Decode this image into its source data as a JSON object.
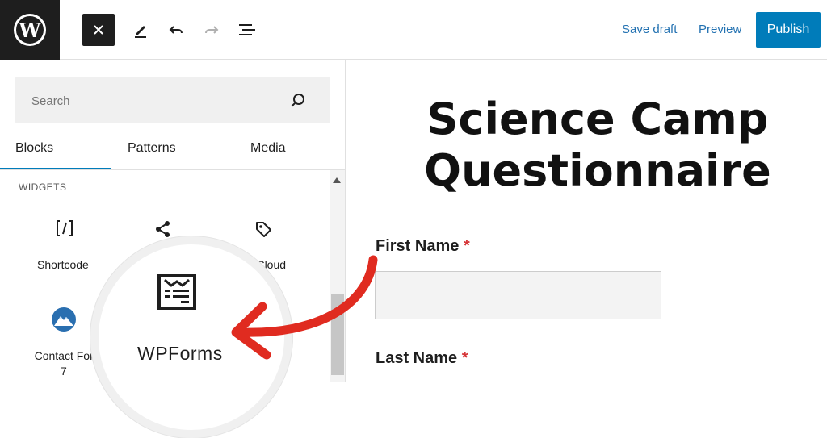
{
  "toolbar": {
    "close_icon": "close-icon",
    "save_draft": "Save draft",
    "preview": "Preview",
    "publish": "Publish"
  },
  "sidebar": {
    "search_placeholder": "Search",
    "tabs": [
      {
        "label": "Blocks",
        "active": true
      },
      {
        "label": "Patterns",
        "active": false
      },
      {
        "label": "Media",
        "active": false
      }
    ],
    "section_label": "WIDGETS",
    "blocks": [
      {
        "label": "Shortcode",
        "icon": "shortcode-icon"
      },
      {
        "label": "",
        "icon": "share-icon"
      },
      {
        "label": "ag Cloud",
        "icon": "tag-icon"
      },
      {
        "label": "Contact Form",
        "label2": "7",
        "icon": "contact-form-7-icon"
      }
    ],
    "spotlight": {
      "label": "WPForms",
      "icon": "wpforms-icon"
    }
  },
  "editor": {
    "title": "Science Camp Questionnaire",
    "fields": [
      {
        "label": "First Name",
        "required_mark": "*"
      },
      {
        "label": "Last Name",
        "required_mark": "*"
      }
    ]
  },
  "colors": {
    "accent": "#007cba",
    "required": "#d63638",
    "arrow": "#e02b20"
  }
}
